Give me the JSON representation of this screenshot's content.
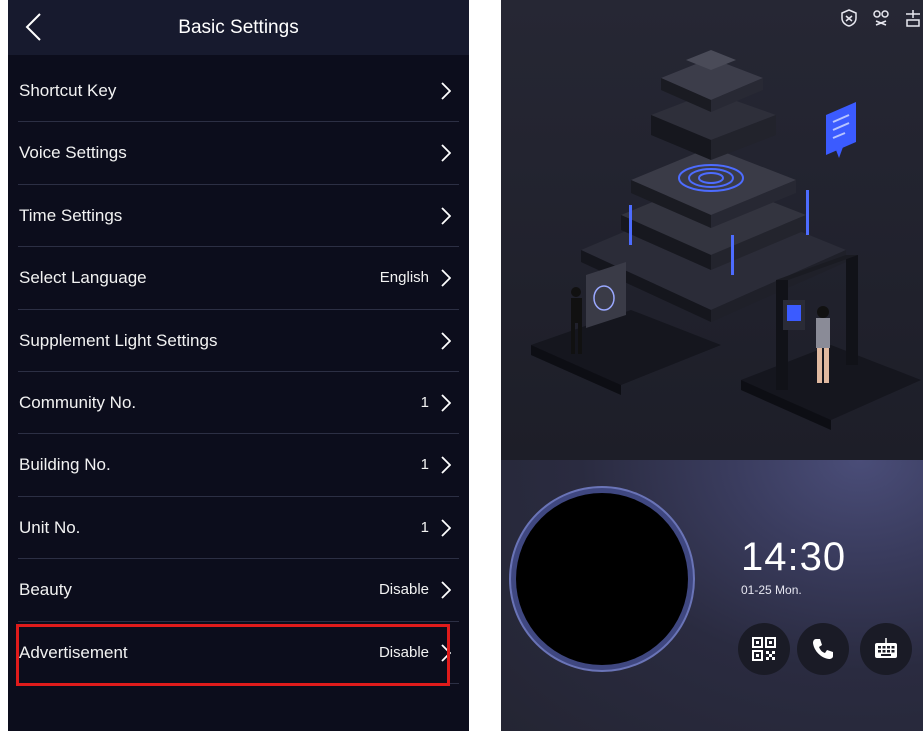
{
  "settings": {
    "title": "Basic Settings",
    "items": [
      {
        "label": "Shortcut Key",
        "value": ""
      },
      {
        "label": "Voice Settings",
        "value": ""
      },
      {
        "label": "Time Settings",
        "value": ""
      },
      {
        "label": "Select Language",
        "value": "English"
      },
      {
        "label": "Supplement Light Settings",
        "value": ""
      },
      {
        "label": "Community No.",
        "value": "1"
      },
      {
        "label": "Building No.",
        "value": "1"
      },
      {
        "label": "Unit No.",
        "value": "1"
      },
      {
        "label": "Beauty",
        "value": "Disable"
      },
      {
        "label": "Advertisement",
        "value": "Disable"
      }
    ],
    "highlighted_item": "Advertisement",
    "highlight_color": "#e01b1b",
    "background_color": "#0c0d1c"
  },
  "home": {
    "time": "14:30",
    "date": "01-25 Mon.",
    "status_icons": [
      "shield-icon",
      "link-icon",
      "network-icon"
    ],
    "actions": [
      {
        "icon": "qr-code-icon"
      },
      {
        "icon": "phone-icon"
      },
      {
        "icon": "keyboard-icon"
      }
    ],
    "accent_color": "#6a74b7"
  }
}
